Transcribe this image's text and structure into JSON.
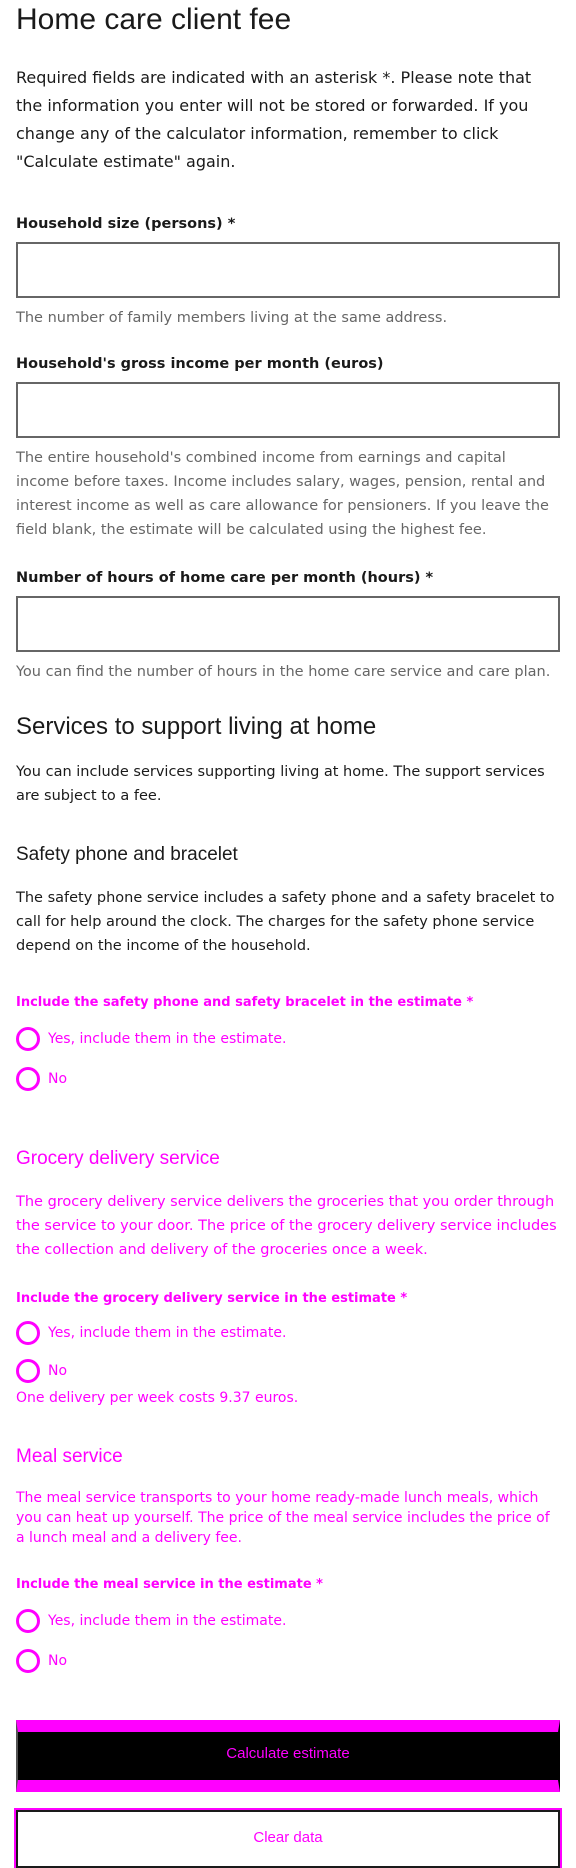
{
  "title": "Home care client fee",
  "intro": "Required fields are indicated with an asterisk *. Please note that the information you enter will not be stored or forwarded. If you change any of the calculator information, remember to click \"Calculate estimate\" again.",
  "fields": {
    "household_size": {
      "label": "Household size (persons) *",
      "value": "",
      "help": "The number of family members living at the same address."
    },
    "gross_income": {
      "label": "Household's gross income per month (euros)",
      "value": "",
      "help": "The entire household's combined income from earnings and capital income before taxes. Income includes salary, wages, pension, rental and interest income as well as care allowance for pensioners. If you leave the field blank, the estimate will be calculated using the highest fee."
    },
    "care_hours": {
      "label": "Number of hours of home care per month (hours) *",
      "value": "",
      "help": "You can find the number of hours in the home care service and care plan."
    }
  },
  "services": {
    "heading": "Services to support living at home",
    "intro": "You can include services supporting living at home. The support services are subject to a fee.",
    "safety_phone": {
      "heading": "Safety phone and bracelet",
      "description": "The safety phone service includes a safety phone and a safety bracelet to call for help around the clock. The charges for the safety phone service depend on the income of the household.",
      "question": "Include the safety phone and safety bracelet in the estimate *",
      "option_yes": "Yes, include them in the estimate.",
      "option_no": "No"
    },
    "grocery": {
      "heading": "Grocery delivery service",
      "description": "The grocery delivery service delivers the groceries that you order through the service to your door. The price of the grocery delivery service includes the collection and delivery of the groceries once a week.",
      "question": "Include the grocery delivery service in the estimate *",
      "option_yes": "Yes, include them in the estimate.",
      "option_no": "No",
      "note": "One delivery per week costs 9.37 euros."
    },
    "meal": {
      "heading": "Meal service",
      "description": "The meal service transports to your home ready-made lunch meals, which you can heat up yourself. The price of the meal service includes the price of a lunch meal and a delivery fee.",
      "question": "Include the meal service in the estimate *",
      "option_yes": "Yes, include them in the estimate.",
      "option_no": "No"
    }
  },
  "actions": {
    "calculate": "Calculate estimate",
    "clear": "Clear data"
  },
  "colors": {
    "text": "#1a1a1a",
    "help_text": "#666666",
    "input_border": "#666666",
    "overlay_magenta": "#ff00ff",
    "primary_button": "#000000"
  }
}
